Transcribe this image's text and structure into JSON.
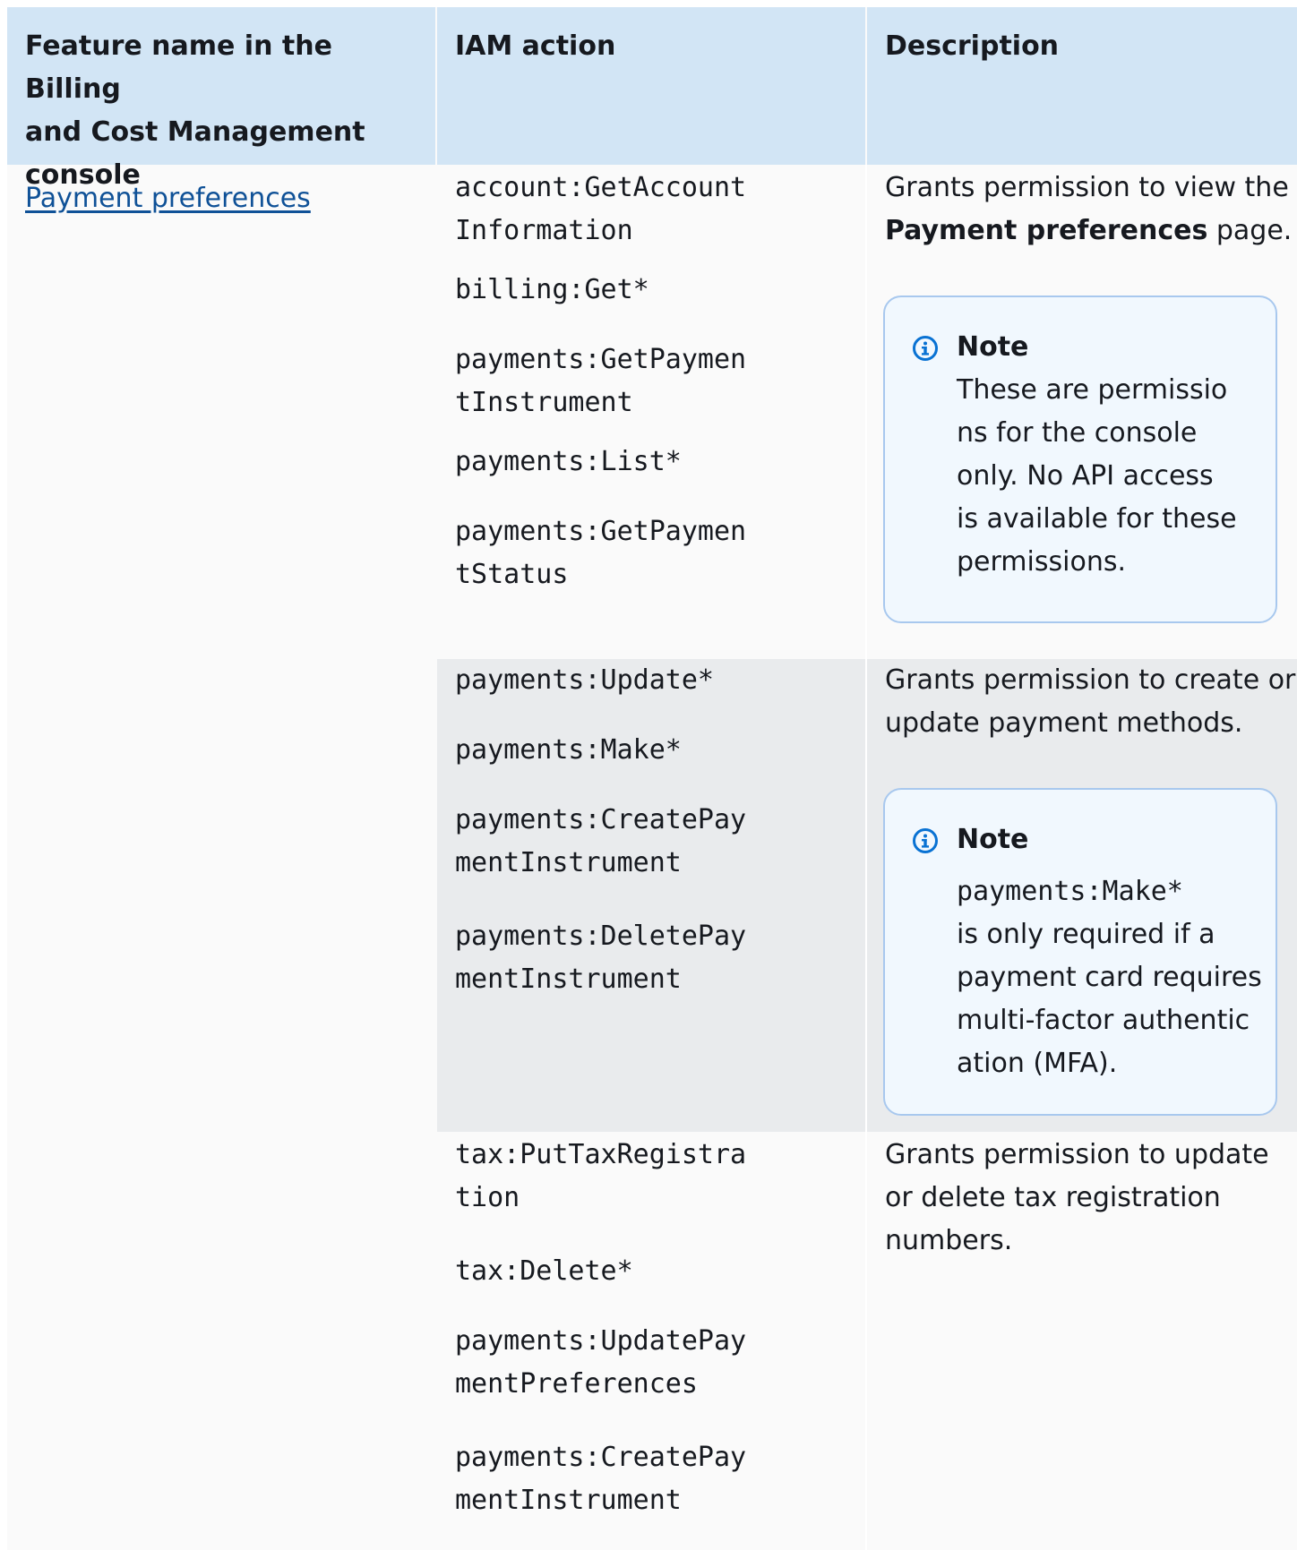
{
  "table": {
    "headers": {
      "feature": [
        "Feature name in the Billing",
        "and Cost Management",
        "console"
      ],
      "action": "IAM action",
      "description": "Description"
    },
    "feature_link": "Payment preferences",
    "rows": [
      {
        "actions": [
          [
            "account:GetAccount",
            "Information"
          ],
          [
            "billing:Get*"
          ],
          [
            "payments:GetPaymen",
            "tInstrument"
          ],
          [
            "payments:List*"
          ],
          [
            "payments:GetPaymen",
            "tStatus"
          ]
        ],
        "description": {
          "line1": "Grants permission to view the",
          "bold": "Payment preferences",
          "after_bold": " page."
        },
        "note": {
          "title": "Note",
          "lines": [
            "These are permissio",
            "ns for the console",
            "only. No API access",
            "is available for these",
            "permissions."
          ]
        }
      },
      {
        "actions": [
          [
            "payments:Update*"
          ],
          [
            "payments:Make*"
          ],
          [
            "payments:CreatePay",
            "mentInstrument"
          ],
          [
            "payments:DeletePay",
            "mentInstrument"
          ]
        ],
        "description": {
          "lines": [
            "Grants permission to create or",
            "update payment methods."
          ]
        },
        "note": {
          "title": "Note",
          "code": "payments:Make*",
          "lines": [
            "is only required if a",
            "payment card requires",
            "multi-factor authentic",
            "ation (MFA)."
          ]
        }
      },
      {
        "actions": [
          [
            "tax:PutTaxRegistra",
            "tion"
          ],
          [
            "tax:Delete*"
          ],
          [
            "payments:UpdatePay",
            "mentPreferences"
          ],
          [
            "payments:CreatePay",
            "mentInstrument"
          ]
        ],
        "description": {
          "lines": [
            "Grants permission to update",
            "or delete tax registration",
            "numbers."
          ]
        }
      }
    ]
  },
  "colors": {
    "header_bg": "#d2e5f5",
    "band_bg": "#e9ebed",
    "link": "#0f5197",
    "note_border": "#a8c8ee",
    "note_bg": "#f1f8fe",
    "info_icon": "#0972d3"
  }
}
